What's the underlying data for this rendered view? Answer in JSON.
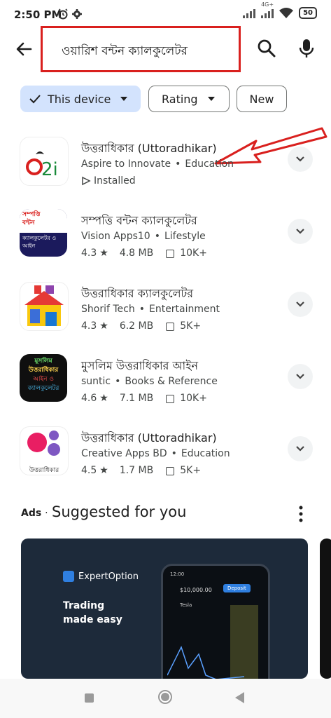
{
  "status_bar": {
    "time": "2:50 PM",
    "battery": "50",
    "network_label": "4G+"
  },
  "search": {
    "query": "ওয়ারিশ বন্টন ক্যালকুলেটর"
  },
  "chips": [
    {
      "label": "This device",
      "selected": true
    },
    {
      "label": "Rating",
      "selected": false
    },
    {
      "label": "New",
      "selected": false
    }
  ],
  "apps": [
    {
      "title": "উত্তরাধিকার (Uttoradhikar)",
      "developer": "Aspire to Innovate",
      "category": "Education",
      "status": "Installed"
    },
    {
      "title": "সম্পত্তি বন্টন ক্যালকুলেটর",
      "developer": "Vision Apps10",
      "category": "Lifestyle",
      "rating": "4.3",
      "size": "4.8 MB",
      "downloads": "10K+",
      "icon_text": [
        "সম্পত্তি",
        "বন্টন",
        "ক্যালকুলেটর ও",
        "আইন"
      ]
    },
    {
      "title": "উত্তরাধিকার ক্যালকুলেটর",
      "developer": "Shorif Tech",
      "category": "Entertainment",
      "rating": "4.3",
      "size": "6.2 MB",
      "downloads": "5K+"
    },
    {
      "title": "মুসলিম উত্তরাধিকার আইন",
      "developer": "suntic",
      "category": "Books & Reference",
      "rating": "4.6",
      "size": "7.1 MB",
      "downloads": "10K+",
      "icon_text": [
        "মুসলিম",
        "উত্তরাধিকার",
        "আইন ও",
        "ক্যালকুলেটর"
      ]
    },
    {
      "title": "উত্তরাধিকার (Uttoradhikar)",
      "developer": "Creative Apps BD",
      "category": "Education",
      "rating": "4.5",
      "size": "1.7 MB",
      "downloads": "5K+",
      "icon_text": "উত্তরাধিকার"
    }
  ],
  "ads": {
    "label": "Ads",
    "title": "Suggested for you",
    "banner_brand": "ExpertOption",
    "banner_tagline_1": "Trading",
    "banner_tagline_2": "made easy",
    "phone_time": "12:00",
    "phone_balance": "$10,000.00",
    "phone_deposit": "Deposit",
    "phone_tab": "Tesla"
  },
  "colors": {
    "accent_chip": "#d3e3fd",
    "highlight_red": "#d9201e",
    "text_primary": "#1f1f1f",
    "text_secondary": "#444746"
  },
  "icons": [
    "alarm-icon",
    "settings-icon",
    "signal-icon",
    "wifi-icon",
    "battery-icon",
    "back-arrow-icon",
    "search-icon",
    "mic-icon",
    "check-icon",
    "chevron-down-icon",
    "star-icon",
    "download-icon",
    "installed-icon",
    "more-vert-icon",
    "nav-recents-icon",
    "nav-home-icon",
    "nav-back-icon"
  ]
}
